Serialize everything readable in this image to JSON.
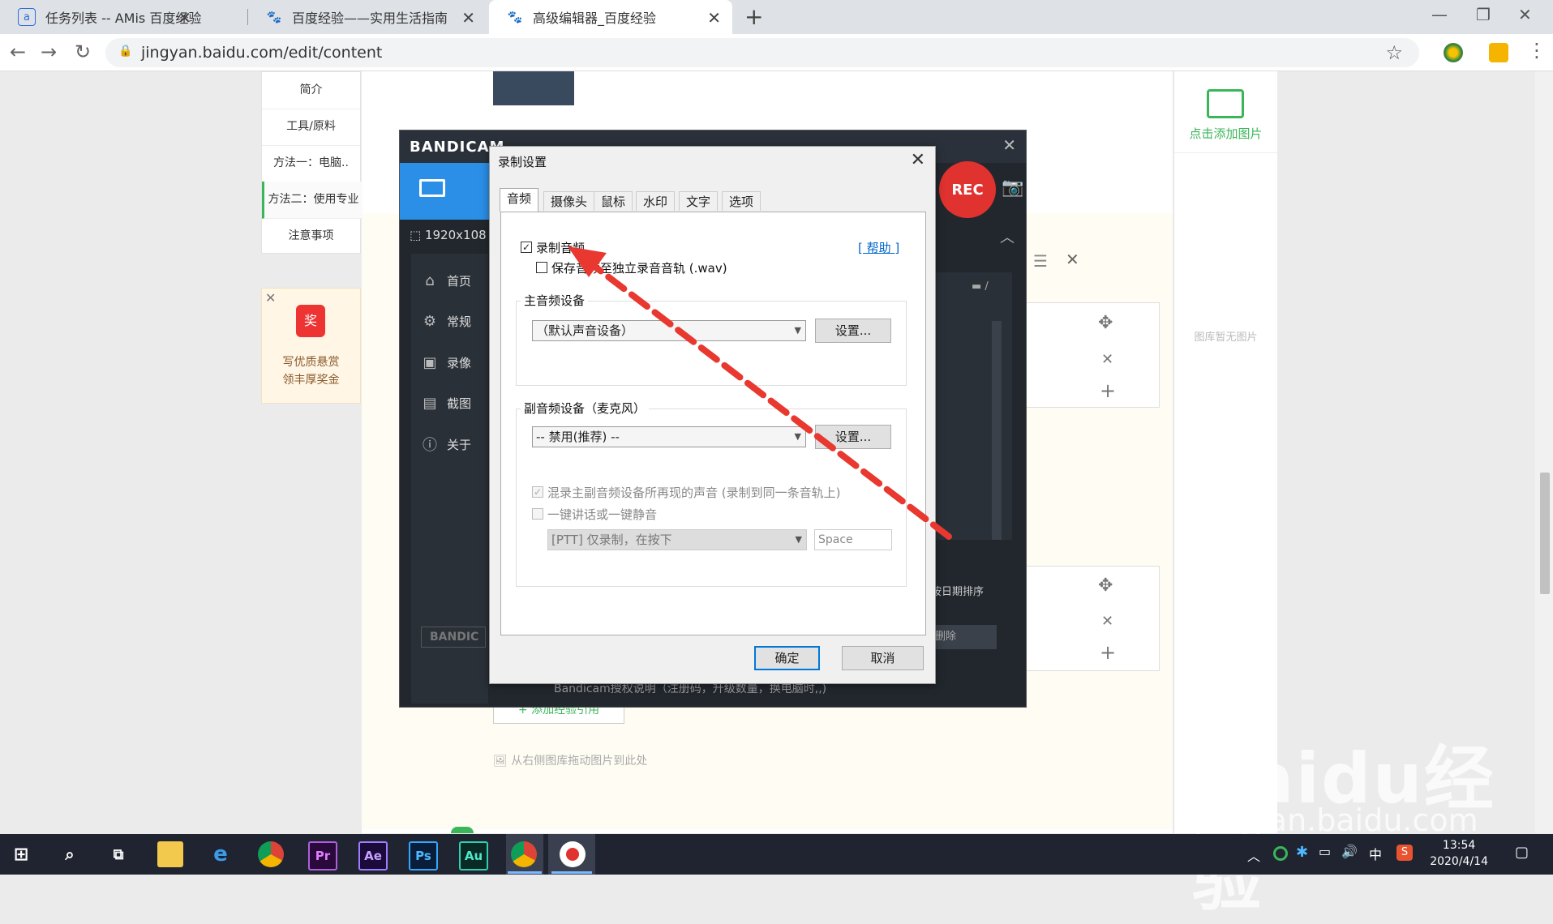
{
  "browser": {
    "tabs": [
      {
        "title": "任务列表 -- AMis 百度经验",
        "icon": "amis-icon"
      },
      {
        "title": "百度经验——实用生活指南",
        "icon": "baidu-paw-icon"
      },
      {
        "title": "高级编辑器_百度经验",
        "icon": "baidu-paw-icon"
      }
    ],
    "url": "jingyan.baidu.com/edit/content"
  },
  "page": {
    "left_nav": [
      "简介",
      "工具/原料",
      "方法一：电脑..",
      "方法二：使用专业",
      "注意事项"
    ],
    "promo": {
      "line1": "写优质悬赏",
      "line2": "领丰厚奖金",
      "badge": "奖"
    },
    "right_panel": {
      "add_image": "点击添加图片",
      "empty": "图库暂无图片"
    },
    "sort_label": "按日期排序",
    "delete_label": "删除",
    "license_text": "Bandicam授权说明（注册码，升级数量，换电脑时,,)",
    "add_ref": "+ 添加经验引用",
    "drag_hint": "从右侧图库拖动图片到此处"
  },
  "bandicam": {
    "brand": "BANDICAM",
    "resolution": "1920x108",
    "rec_label": "REC",
    "footer_brand": "BANDIC",
    "nav": [
      {
        "label": "首页",
        "icon": "home-icon"
      },
      {
        "label": "常规",
        "icon": "gear-icon"
      },
      {
        "label": "录像",
        "icon": "video-icon"
      },
      {
        "label": "截图",
        "icon": "screenshot-icon"
      },
      {
        "label": "关于",
        "icon": "info-icon"
      }
    ]
  },
  "dialog": {
    "title": "录制设置",
    "tabs": [
      "音频",
      "摄像头",
      "鼠标",
      "水印",
      "文字",
      "选项"
    ],
    "record_audio": "录制音频",
    "help": "[ 帮助 ]",
    "save_separate": "保存音频至独立录音音轨 (.wav)",
    "primary_group": "主音频设备",
    "primary_device": "（默认声音设备）",
    "settings_btn": "设置...",
    "secondary_group": "副音频设备（麦克风）",
    "secondary_device": "-- 禁用(推荐) --",
    "mix_label": "混录主副音频设备所再现的声音 (录制到同一条音轨上)",
    "ptt_label": "一键讲话或一键静音",
    "ptt_select": "[PTT] 仅录制，在按下",
    "ptt_key": "Space",
    "ok": "确定",
    "cancel": "取消"
  },
  "taskbar": {
    "time": "13:54",
    "date": "2020/4/14",
    "ime": "中",
    "apps": [
      "Pr",
      "Ae",
      "Ps",
      "Au"
    ]
  },
  "watermark": {
    "big": "Baidu经验",
    "small": "jingyan.baidu.com"
  },
  "colors": {
    "accent_green": "#3bb55a",
    "rec_red": "#e0322e",
    "annotation_red": "#e8382f",
    "bandicam_blue": "#2b8fe8"
  }
}
